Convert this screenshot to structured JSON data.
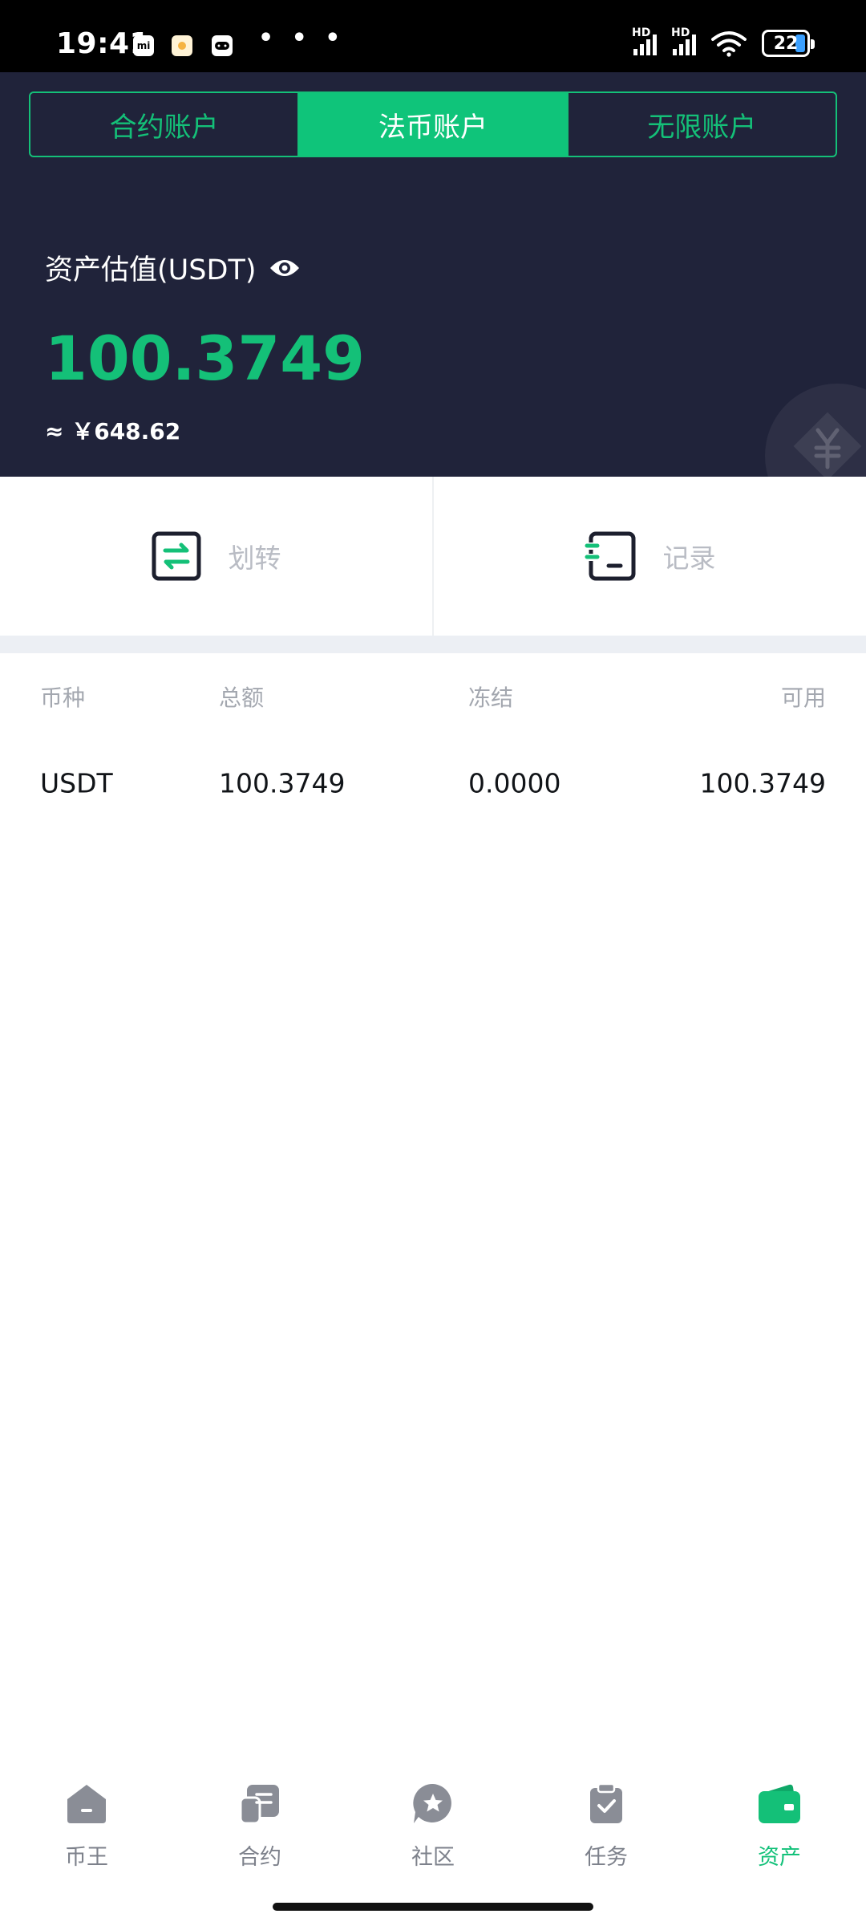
{
  "status_bar": {
    "time": "19:41",
    "app_icons": [
      "mi-icon",
      "weather-icon",
      "gamepad-icon"
    ],
    "more": "• • •",
    "network_label": "HD",
    "battery": "22"
  },
  "tabs": [
    {
      "label": "合约账户",
      "active": false
    },
    {
      "label": "法币账户",
      "active": true
    },
    {
      "label": "无限账户",
      "active": false
    }
  ],
  "asset": {
    "label": "资产估值(USDT)",
    "value": "100.3749",
    "cny": "≈ ￥648.62"
  },
  "actions": {
    "transfer_label": "划转",
    "records_label": "记录"
  },
  "table": {
    "headers": [
      "币种",
      "总额",
      "冻结",
      "可用"
    ],
    "rows": [
      [
        "USDT",
        "100.3749",
        "0.0000",
        "100.3749"
      ]
    ]
  },
  "bottom_nav": [
    {
      "label": "币王",
      "icon": "home-icon",
      "active": false
    },
    {
      "label": "合约",
      "icon": "contract-icon",
      "active": false
    },
    {
      "label": "社区",
      "icon": "community-icon",
      "active": false
    },
    {
      "label": "任务",
      "icon": "task-icon",
      "active": false
    },
    {
      "label": "资产",
      "icon": "wallet-icon",
      "active": true
    }
  ],
  "colors": {
    "accent": "#14c078",
    "header_bg": "#20233a",
    "nav_inactive": "#8a8d96"
  }
}
